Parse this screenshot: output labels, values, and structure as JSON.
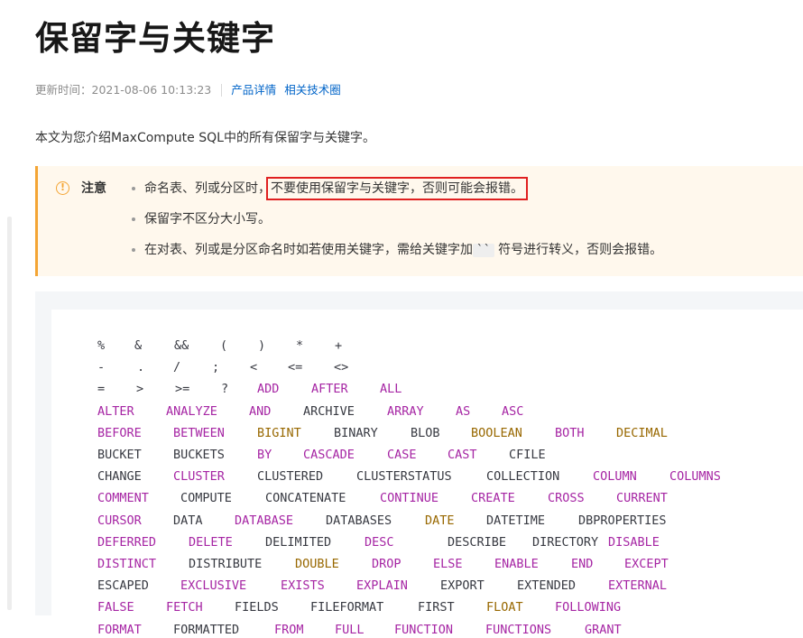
{
  "title": "保留字与关键字",
  "meta": {
    "update_label": "更新时间：2021-08-06 10:13:23",
    "links": [
      "产品详情",
      "相关技术圈"
    ]
  },
  "intro": "本文为您介绍MaxCompute SQL中的所有保留字与关键字。",
  "note": {
    "icon": "exclamation-circle-icon",
    "label": "注意",
    "item1_prefix": "命名表、列或分区时，",
    "item1_highlight": "不要使用保留字与关键字，否则可能会报错。",
    "item2": "保留字不区分大小写。",
    "item3_prefix": "在对表、列或是分区命名时如若使用关键字，需给关键字加",
    "item3_code": "``",
    "item3_suffix": "符号进行转义，否则会报错。"
  },
  "colors": {
    "keyword": "#a626a4",
    "type": "#986801",
    "plain": "#383a42",
    "note_border": "#f4a534",
    "note_bg": "#fff8ed",
    "link": "#0064c8",
    "highlight_box": "#e02020"
  },
  "code_lines": [
    [
      [
        "%",
        "o"
      ],
      [
        "&",
        "o"
      ],
      [
        "&&",
        "o"
      ],
      [
        "(",
        "o"
      ],
      [
        ")",
        "o"
      ],
      [
        "*",
        "o"
      ],
      [
        "+",
        "o"
      ]
    ],
    [
      [
        "-",
        "o"
      ],
      [
        ".",
        "o"
      ],
      [
        "/",
        "o"
      ],
      [
        ";",
        "o"
      ],
      [
        "<",
        "o"
      ],
      [
        "<=",
        "o"
      ],
      [
        "<>",
        "o"
      ]
    ],
    [
      [
        "=",
        "o"
      ],
      [
        ">",
        "o"
      ],
      [
        ">=",
        "o"
      ],
      [
        "?",
        "o"
      ],
      [
        "ADD",
        "k"
      ],
      [
        "AFTER",
        "k"
      ],
      [
        "ALL",
        "k"
      ]
    ],
    [
      [
        "ALTER",
        "k"
      ],
      [
        "ANALYZE",
        "k"
      ],
      [
        "AND",
        "k"
      ],
      [
        "ARCHIVE",
        "p"
      ],
      [
        "ARRAY",
        "k"
      ],
      [
        "AS",
        "k"
      ],
      [
        "ASC",
        "k"
      ]
    ],
    [
      [
        "BEFORE",
        "k"
      ],
      [
        "BETWEEN",
        "k"
      ],
      [
        "BIGINT",
        "t"
      ],
      [
        "BINARY",
        "p"
      ],
      [
        "BLOB",
        "p"
      ],
      [
        "BOOLEAN",
        "t"
      ],
      [
        "BOTH",
        "k"
      ],
      [
        "DECIMAL",
        "t"
      ]
    ],
    [
      [
        "BUCKET",
        "p"
      ],
      [
        "BUCKETS",
        "p"
      ],
      [
        "BY",
        "k"
      ],
      [
        "CASCADE",
        "k"
      ],
      [
        "CASE",
        "k"
      ],
      [
        "CAST",
        "k"
      ],
      [
        "CFILE",
        "p"
      ]
    ],
    [
      [
        "CHANGE",
        "p"
      ],
      [
        "CLUSTER",
        "k"
      ],
      [
        "CLUSTERED",
        "p"
      ],
      [
        "CLUSTERSTATUS",
        "p"
      ],
      [
        "COLLECTION",
        "p"
      ],
      [
        "COLUMN",
        "k"
      ],
      [
        "COLUMNS",
        "k"
      ]
    ],
    [
      [
        "COMMENT",
        "k"
      ],
      [
        "COMPUTE",
        "p"
      ],
      [
        "CONCATENATE",
        "p"
      ],
      [
        "CONTINUE",
        "k"
      ],
      [
        "CREATE",
        "k"
      ],
      [
        "CROSS",
        "k"
      ],
      [
        "CURRENT",
        "k"
      ]
    ],
    [
      [
        "CURSOR",
        "k"
      ],
      [
        "DATA",
        "p"
      ],
      [
        "DATABASE",
        "k"
      ],
      [
        "DATABASES",
        "p"
      ],
      [
        "DATE",
        "t"
      ],
      [
        "DATETIME",
        "p"
      ],
      [
        "DBPROPERTIES",
        "p"
      ]
    ],
    [
      [
        "DEFERRED",
        "k"
      ],
      [
        "DELETE",
        "k"
      ],
      [
        "DELIMITED",
        "p"
      ],
      [
        "DESC",
        "k"
      ],
      [
        "DESCRIBE",
        "p"
      ],
      [
        "DIRECTORY",
        "p"
      ],
      [
        "DISABLE",
        "k"
      ]
    ],
    [
      [
        "DISTINCT",
        "k"
      ],
      [
        "DISTRIBUTE",
        "p"
      ],
      [
        "DOUBLE",
        "t"
      ],
      [
        "DROP",
        "k"
      ],
      [
        "ELSE",
        "k"
      ],
      [
        "ENABLE",
        "k"
      ],
      [
        "END",
        "k"
      ],
      [
        "EXCEPT",
        "k"
      ]
    ],
    [
      [
        "ESCAPED",
        "p"
      ],
      [
        "EXCLUSIVE",
        "k"
      ],
      [
        "EXISTS",
        "k"
      ],
      [
        "EXPLAIN",
        "k"
      ],
      [
        "EXPORT",
        "p"
      ],
      [
        "EXTENDED",
        "p"
      ],
      [
        "EXTERNAL",
        "k"
      ]
    ],
    [
      [
        "FALSE",
        "k"
      ],
      [
        "FETCH",
        "k"
      ],
      [
        "FIELDS",
        "p"
      ],
      [
        "FILEFORMAT",
        "p"
      ],
      [
        "FIRST",
        "p"
      ],
      [
        "FLOAT",
        "t"
      ],
      [
        "FOLLOWING",
        "k"
      ]
    ],
    [
      [
        "FORMAT",
        "k"
      ],
      [
        "FORMATTED",
        "p"
      ],
      [
        "FROM",
        "k"
      ],
      [
        "FULL",
        "k"
      ],
      [
        "FUNCTION",
        "k"
      ],
      [
        "FUNCTIONS",
        "k"
      ],
      [
        "GRANT",
        "k"
      ]
    ]
  ]
}
